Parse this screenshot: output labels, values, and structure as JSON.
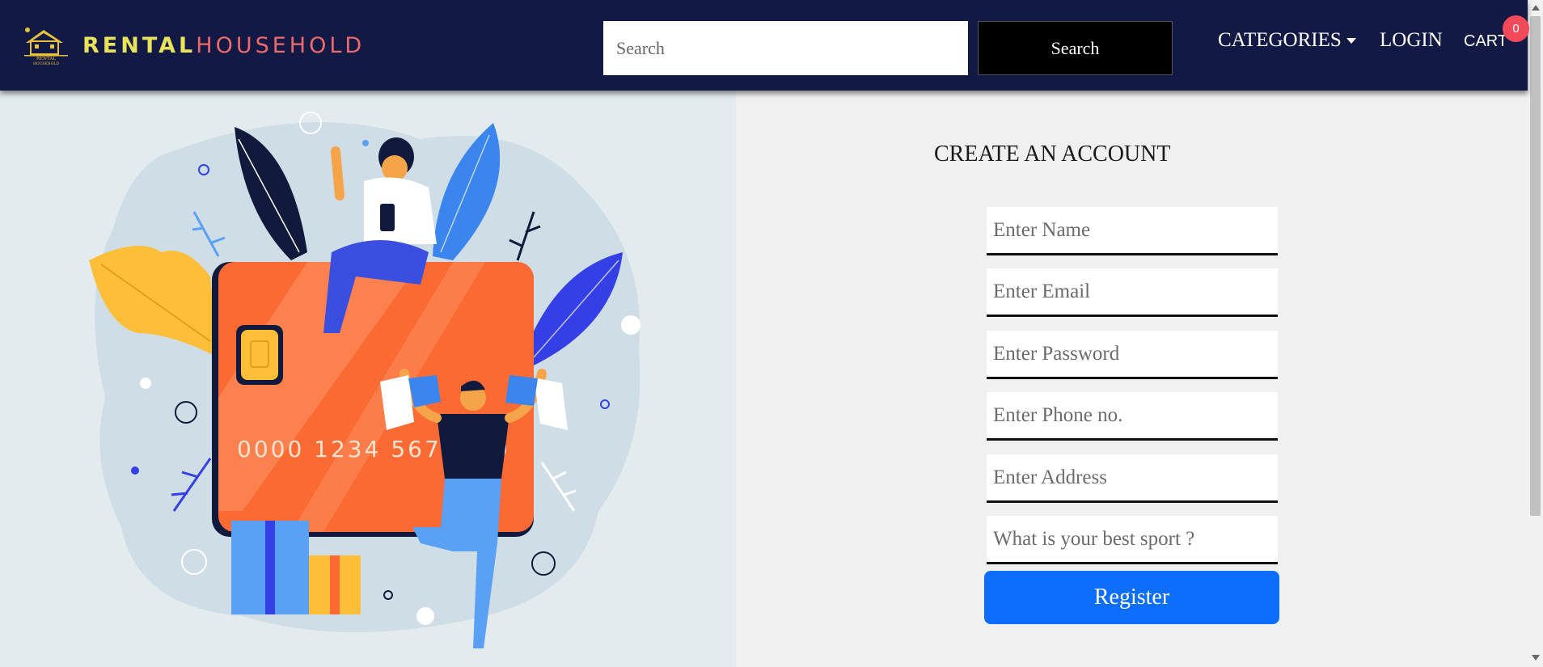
{
  "brand": {
    "name_part1": "RENTAL",
    "name_part2": "HOUSEHOLD",
    "logo_caption": "RENTAL HOUSEHOLD"
  },
  "search": {
    "placeholder": "Search",
    "button_label": "Search"
  },
  "nav": {
    "categories_label": "CATEGORIES",
    "login_label": "LOGIN",
    "cart_label": "CART",
    "cart_count": "0"
  },
  "illustration": {
    "card_number": "0000 1234 5678 9"
  },
  "form": {
    "title": "CREATE AN ACCOUNT",
    "fields": [
      {
        "placeholder": "Enter Name"
      },
      {
        "placeholder": "Enter Email"
      },
      {
        "placeholder": "Enter Password"
      },
      {
        "placeholder": "Enter Phone no."
      },
      {
        "placeholder": "Enter Address"
      },
      {
        "placeholder": "What is your best sport ?"
      }
    ],
    "submit_label": "Register"
  },
  "colors": {
    "navbar": "#131945",
    "accent": "#0d6efd",
    "brand_yellow": "#e8e35a",
    "brand_red": "#ee6a6a",
    "badge": "#f24a5a"
  }
}
